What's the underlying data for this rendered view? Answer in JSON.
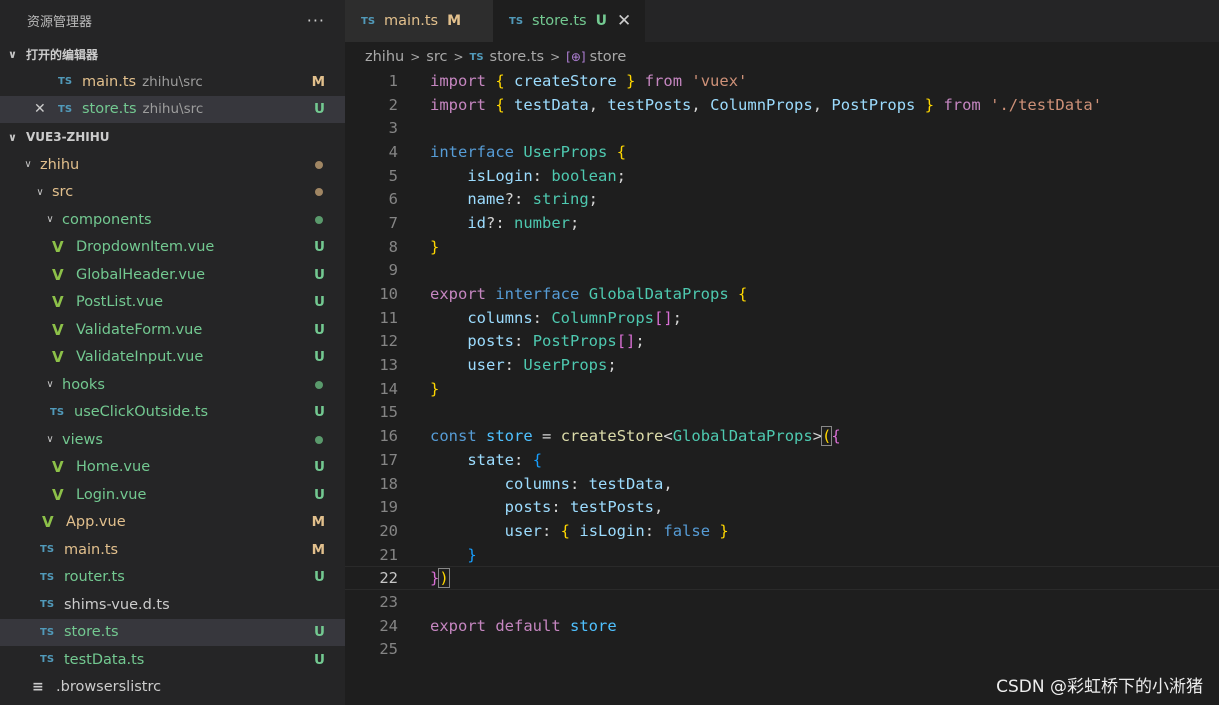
{
  "sidebar": {
    "title": "资源管理器",
    "more": "···",
    "open_editors": {
      "label": "打开的编辑器",
      "items": [
        {
          "name": "main.ts",
          "desc": "zhihu\\src",
          "badge": "M"
        },
        {
          "name": "store.ts",
          "desc": "zhihu\\src",
          "badge": "U"
        }
      ]
    },
    "project": {
      "label": "VUE3-ZHIHU",
      "tree": [
        {
          "name": "zhihu"
        },
        {
          "name": "src"
        },
        {
          "name": "components"
        },
        {
          "name": "DropdownItem.vue",
          "badge": "U"
        },
        {
          "name": "GlobalHeader.vue",
          "badge": "U"
        },
        {
          "name": "PostList.vue",
          "badge": "U"
        },
        {
          "name": "ValidateForm.vue",
          "badge": "U"
        },
        {
          "name": "ValidateInput.vue",
          "badge": "U"
        },
        {
          "name": "hooks"
        },
        {
          "name": "useClickOutside.ts",
          "badge": "U"
        },
        {
          "name": "views"
        },
        {
          "name": "Home.vue",
          "badge": "U"
        },
        {
          "name": "Login.vue",
          "badge": "U"
        },
        {
          "name": "App.vue",
          "badge": "M"
        },
        {
          "name": "main.ts",
          "badge": "M"
        },
        {
          "name": "router.ts",
          "badge": "U"
        },
        {
          "name": "shims-vue.d.ts"
        },
        {
          "name": "store.ts",
          "badge": "U"
        },
        {
          "name": "testData.ts",
          "badge": "U"
        },
        {
          "name": ".browserslistrc"
        }
      ]
    }
  },
  "tabs": [
    {
      "label": "main.ts",
      "badge": "M",
      "icon": "TS"
    },
    {
      "label": "store.ts",
      "badge": "U",
      "icon": "TS",
      "close": "✕"
    }
  ],
  "breadcrumb": [
    "zhihu",
    "src",
    "store.ts",
    "store"
  ],
  "code": {
    "line_numbers": [
      "1",
      "2",
      "3",
      "4",
      "5",
      "6",
      "7",
      "8",
      "9",
      "10",
      "11",
      "12",
      "13",
      "14",
      "15",
      "16",
      "17",
      "18",
      "19",
      "20",
      "21",
      "22",
      "23",
      "24",
      "25"
    ],
    "current_line": "22"
  },
  "watermark": "CSDN @彩虹桥下的小淅猪"
}
